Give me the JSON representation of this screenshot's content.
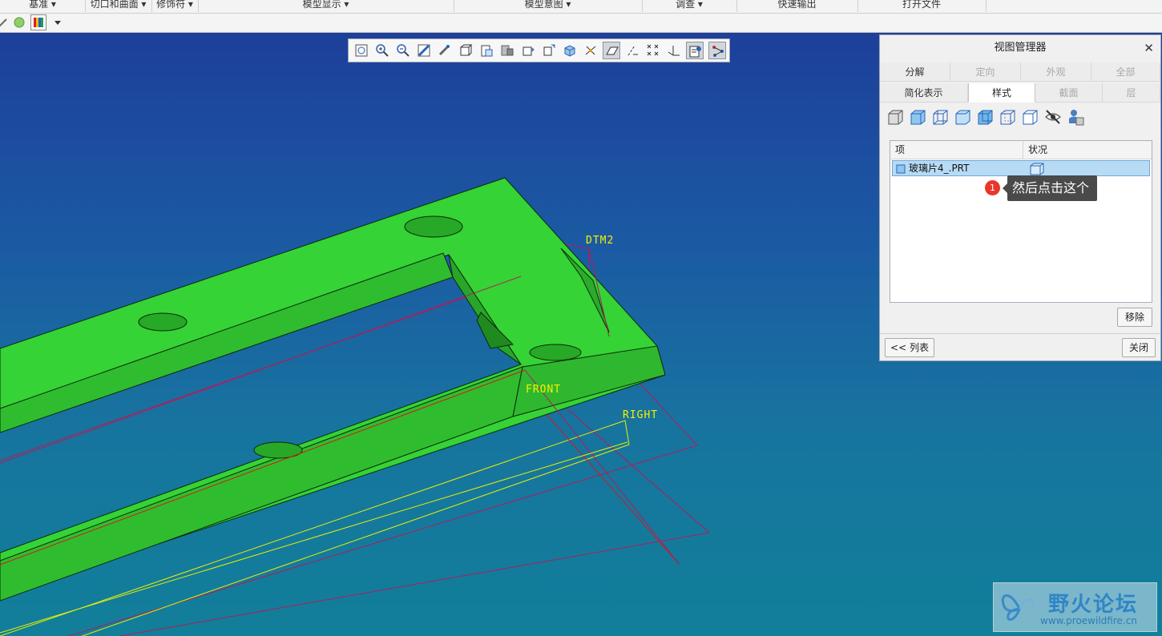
{
  "ribbon": {
    "groups": [
      "基准",
      "切口和曲面",
      "修饰符",
      "模型显示",
      "模型意图",
      "调查",
      "快速输出",
      "打开文件"
    ]
  },
  "viewport": {
    "datum_labels": {
      "dtm2": "DTM2",
      "front": "FRONT",
      "right": "RIGHT"
    },
    "colors": {
      "part": "#35d335",
      "bg_top": "#1d3f9a",
      "bg_bottom": "#117f9a",
      "datum": "#f4f000"
    }
  },
  "graphics_toolbar": {
    "icons": [
      "refit-icon",
      "zoom-in-icon",
      "zoom-out-icon",
      "repaint-icon",
      "spin-center-icon",
      "saved-orientations-icon",
      "named-views-icon",
      "display-style-icon",
      "view-manager-icon",
      "perspective-icon",
      "shaded-icon",
      "datum-display-icon",
      "plane-display-icon",
      "axis-display-icon",
      "point-display-icon",
      "csys-display-icon",
      "annotation-display-icon",
      "spin-center-toggle-icon"
    ]
  },
  "view_manager": {
    "title": "视图管理器",
    "tabs_row1": [
      "分解",
      "定向",
      "外观",
      "全部"
    ],
    "tabs_row2": [
      "简化表示",
      "样式",
      "截面",
      "层"
    ],
    "style_icons": [
      "shaded-style-icon",
      "shaded-edges-icon",
      "wireframe-icon",
      "shaded-blank-icon",
      "transparent-icon",
      "hidden-line-icon",
      "no-hidden-icon",
      "hide-icon",
      "show-layer-icon"
    ],
    "columns": [
      "项",
      "状况"
    ],
    "rows": [
      {
        "item": "玻璃片4_.PRT"
      }
    ],
    "remove_label": "移除",
    "list_label": "<< 列表",
    "close_label": "关闭"
  },
  "tooltip": {
    "badge": "1",
    "text": "然后点击这个"
  },
  "watermark": {
    "name": "野火论坛",
    "url": "www.proewildfire.cn"
  }
}
